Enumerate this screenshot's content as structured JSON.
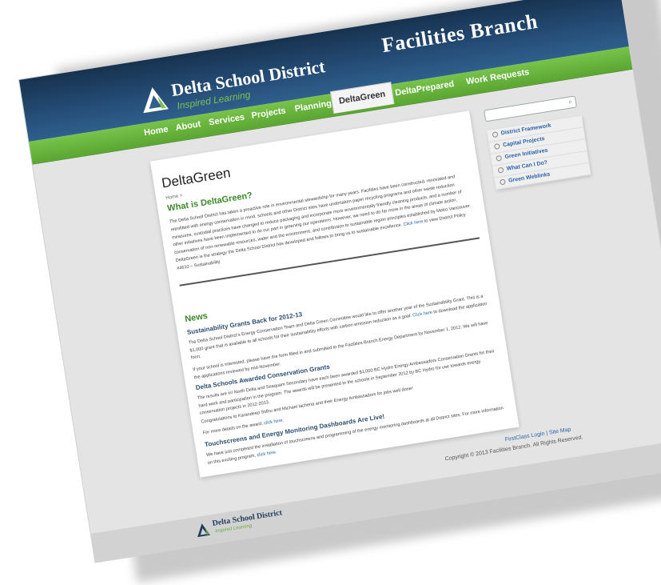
{
  "header": {
    "district_name": "Delta School District",
    "tagline": "Inspired Learning",
    "branch_title": "Facilities Branch"
  },
  "nav": {
    "items": [
      {
        "label": "Home"
      },
      {
        "label": "About"
      },
      {
        "label": "Services"
      },
      {
        "label": "Projects"
      },
      {
        "label": "Planning"
      },
      {
        "label": "DeltaGreen"
      },
      {
        "label": "DeltaPrepared"
      },
      {
        "label": "Work Requests"
      }
    ],
    "active": "DeltaGreen"
  },
  "content": {
    "page_title": "DeltaGreen",
    "breadcrumb": "Home >",
    "section_heading": "What is DeltaGreen?",
    "intro_text": "The Delta School District has taken a proactive role in environmental stewardship for many years. Facilities have been constructed, renovated and retrofitted with energy conservation in mind, schools and other District sites have undertaken paper recycling programs and other waste reduction measures, custodial practices have changed to reduce packaging and incorporate more environmentally friendly cleaning products, and a number of other initiatives have been implemented to do our part in greening our operations. However, we need to do far more in the areas of climate action, conservation of non-renewable resources, water and the environment, and contribution to sustainable region principles established by Metro Vancouver. DeltaGreen is the strategy the Delta School District has developed and follows to bring us to sustainable excellence.",
    "intro_link": "Click here",
    "intro_tail": "to view District Policy #4610 – Sustainability.",
    "news_heading": "News",
    "news": [
      {
        "title": "Sustainability Grants Back for 2012-13",
        "para1": "The Delta School District's Energy Conservation Team and Delta Green Committee would like to offer another year of the Sustainability Grant. This is a $1,000 grant that is available to all schools for their sustainability efforts with carbon emission reduction as a goal.",
        "link1": "Click here",
        "para1_tail": "to download the application form.",
        "para2": "If your school is interested, please have the form filled in and submitted to the Facilities Branch Energy Department by November 1, 2012. We will have the applications reviewed by mid-November."
      },
      {
        "title": "Delta Schools Awarded Conservation Grants",
        "para1": "The results are in! North Delta and Seaquam Secondary have each been awarded $1,000 BC Hydro Energy Ambassadors Conservation Grants for their hard work and participation in the program. The awards will be presented to the schools in September 2012 by BC Hydro for use towards energy conservation projects in 2012-2013.",
        "para2": "Congratulations to Karandeep Sidhu and Michael Iacheria and their Energy Ambassadors for jobs well done!",
        "para3": "For more details on the award,",
        "link3": "click here."
      },
      {
        "title": "Touchscreens and Energy Monitoring Dashboards Are Live!",
        "para1": "We have just completed the installation of touchscreens and programming of the energy monitoring dashboards at all District sites. For more information on this exciting program,",
        "link1": "click here."
      }
    ]
  },
  "sidebar": {
    "search_placeholder": "",
    "links": [
      {
        "label": "District Framework"
      },
      {
        "label": "Capital Projects"
      },
      {
        "label": "Green Initiatives"
      },
      {
        "label": "What Can I Do?"
      },
      {
        "label": "Green Weblinks"
      }
    ]
  },
  "footer": {
    "link_login": "FirstClass Login",
    "separator": "|",
    "link_sitemap": "Site Map",
    "copyright": "Copyright © 2013 Facilities Branch. All Rights Reserved.",
    "district_name": "Delta School District",
    "tagline": "Inspired Learning"
  },
  "colors": {
    "header_blue": "#254d77",
    "nav_green": "#6cb43f",
    "heading_green": "#3d8a2b",
    "link_blue": "#2a63a8"
  }
}
